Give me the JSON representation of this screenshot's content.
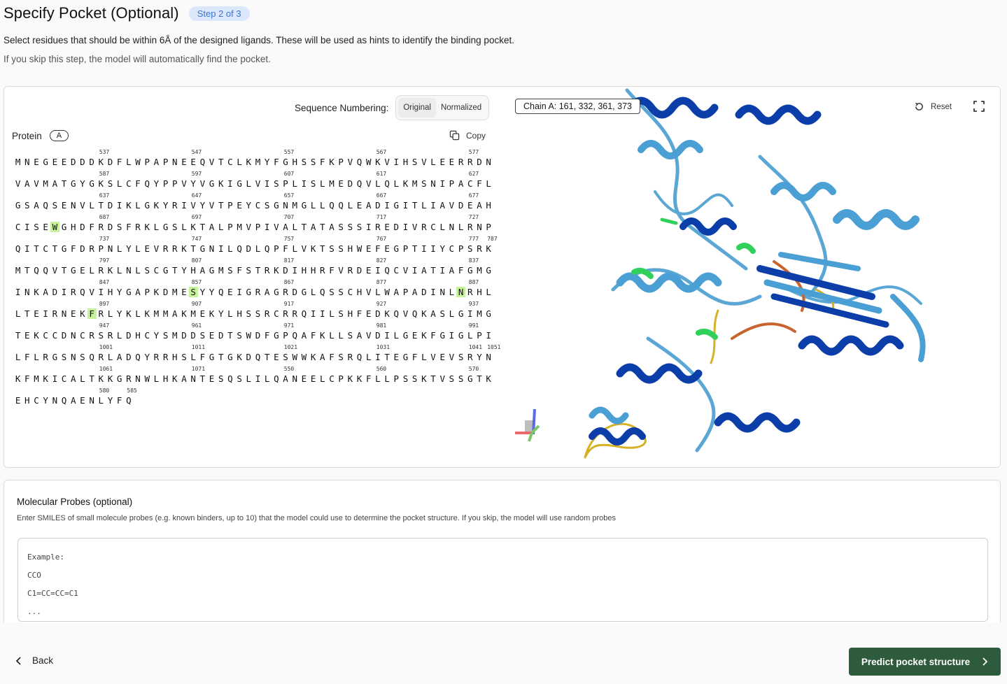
{
  "header": {
    "title": "Specify Pocket (Optional)",
    "step": "Step 2 of 3",
    "description": "Select residues that should be within 6Å of the designed ligands. These will be used as hints to identify the binding pocket.",
    "skip_note": "If you skip this step, the model will automatically find the pocket."
  },
  "sequence_panel": {
    "numbering_label": "Sequence Numbering:",
    "numbering_options": [
      "Original",
      "Normalized"
    ],
    "numbering_selected": "Original",
    "protein_label": "Protein",
    "chain_id": "A",
    "copy_label": "Copy",
    "lines": [
      {
        "ticks": [
          "537",
          "547",
          "557",
          "567",
          "577"
        ],
        "seq": "MNEGEEDDDKDFLWPAPNEEQVTCLKMYFGHSSFKPVQWKVIHSVLEERRDN",
        "hl": []
      },
      {
        "ticks": [
          "587",
          "597",
          "607",
          "617",
          "627"
        ],
        "seq": "VAVMATGYGKSLCFQYPPVYVGKIGLVISPLISLMEDQVLQLKMSNIPACFL",
        "hl": []
      },
      {
        "ticks": [
          "637",
          "647",
          "657",
          "667",
          "677"
        ],
        "seq": "GSAQSENVLTDIKLGKYRIVYVTPEYCSGNMGLLQQLEADIGITLIAVDEAH",
        "hl": []
      },
      {
        "ticks": [
          "687",
          "697",
          "707",
          "717",
          "727"
        ],
        "seq": "CISEWGHDFRDSFRKLGSLKTALPMVPIVALTATASSSIREDIVRCLNLRNP",
        "hl": [
          4
        ]
      },
      {
        "ticks": [
          "737",
          "747",
          "757",
          "767",
          "777",
          "787"
        ],
        "seq": "QITCTGFDRPNLYLEVRRKTGNILQDLQPFLVKTSSHWEFEGPTIIYCPSRK",
        "hl": []
      },
      {
        "ticks": [
          "797",
          "807",
          "817",
          "827",
          "837"
        ],
        "seq": "MTQQVTGELRKLNLSCGTYHAGMSFSTRKDIHHRFVRDEIQCVIATIAFGMG",
        "hl": []
      },
      {
        "ticks": [
          "847",
          "857",
          "867",
          "877",
          "887"
        ],
        "seq": "INKADIRQVIHYGAPKDMESYYQEIGRAGRDGLQSSCHVLWAPADINLNRHL",
        "hl": [
          19,
          48
        ]
      },
      {
        "ticks": [
          "897",
          "907",
          "917",
          "927",
          "937"
        ],
        "seq": "LTEIRNEKFRLYKLKMMAKMEKYLHSSRCRRQIILSHFEDKQVQKASLGIMG",
        "hl": [
          8
        ]
      },
      {
        "ticks": [
          "947",
          "961",
          "971",
          "981",
          "991"
        ],
        "seq": "TEKCCDNCRSRLDHCYSMDDSEDTSWDFGPQAFKLLSAVDILGEKFGIGLPI",
        "hl": []
      },
      {
        "ticks": [
          "1001",
          "1011",
          "1021",
          "1031",
          "1041",
          "1051"
        ],
        "seq": "LFLRGSNSQRLADQYRRHSLFGTGKDQTESWWKAFSRQLITEGFLVEVSRYN",
        "hl": []
      },
      {
        "ticks": [
          "1061",
          "1071",
          "550",
          "560",
          "570"
        ],
        "seq": "KFMKICALTKKGRNWLHKANTESQSLILQANEELCPKKFLLPSSKTVSSGTK",
        "hl": []
      },
      {
        "ticks": [
          "580",
          "585"
        ],
        "seq": "EHCYNQAENLYFQ",
        "hl": []
      }
    ]
  },
  "viewer": {
    "chain_selection": "Chain A: 161, 332, 361, 373",
    "reset_label": "Reset",
    "icons": [
      "reset-icon",
      "fullscreen-icon"
    ]
  },
  "probes": {
    "title": "Molecular Probes (optional)",
    "description": "Enter SMILES of small molecule probes (e.g. known binders, up to 10) that the model could use to determine the pocket structure. If you skip, the model will use random probes",
    "placeholder": "Example:\nCCO\nC1=CC=CC=C1\n..."
  },
  "footer": {
    "back_label": "Back",
    "predict_label": "Predict pocket structure"
  },
  "colors": {
    "primary_button": "#2f5b3d",
    "highlight": "#c6f29c",
    "step_badge_bg": "#dbe8fb",
    "step_badge_text": "#3a73d1"
  }
}
